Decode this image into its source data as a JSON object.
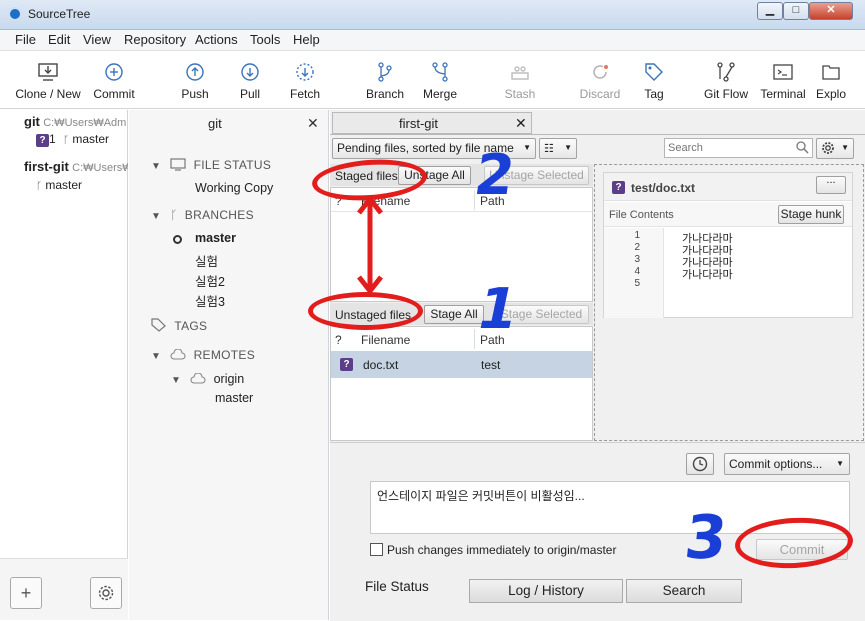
{
  "window": {
    "title": "SourceTree",
    "min": "▁",
    "max": "□",
    "close": "✕"
  },
  "menu": [
    "File",
    "Edit",
    "View",
    "Repository",
    "Actions",
    "Tools",
    "Help"
  ],
  "toolbar": {
    "clone": "Clone / New",
    "commit": "Commit",
    "push": "Push",
    "pull": "Pull",
    "fetch": "Fetch",
    "branch": "Branch",
    "merge": "Merge",
    "stash": "Stash",
    "discard": "Discard",
    "tag": "Tag",
    "gitflow": "Git Flow",
    "terminal": "Terminal",
    "explorer": "Explo"
  },
  "repos": [
    {
      "name": "git",
      "path": "C:₩Users₩Adm",
      "badge": "?",
      "badge_count": "1",
      "branch": "master"
    },
    {
      "name": "first-git",
      "path": "C:₩Users₩",
      "branch": "master"
    }
  ],
  "repo_scroll": "|||",
  "repo_add": "+",
  "sidebar": {
    "tab_title": "git",
    "close": "✕",
    "file_status": "FILE STATUS",
    "working_copy": "Working Copy",
    "branches": "BRANCHES",
    "branch_list": [
      "master",
      "실험",
      "실험2",
      "실험3"
    ],
    "tags": "TAGS",
    "remotes": "REMOTES",
    "remote_name": "origin",
    "remote_branch": "master"
  },
  "main": {
    "tab_title": "first-git",
    "tab_close": "✕",
    "sort_dropdown": "Pending files, sorted by file name",
    "search_placeholder": "Search",
    "staged": {
      "title": "Staged files",
      "unstage_all": "Unstage All",
      "unstage_selected": "Unstage Selected"
    },
    "unstaged": {
      "title": "Unstaged files",
      "stage_all": "Stage All",
      "stage_selected": "Stage Selected"
    },
    "columns": {
      "status": "?",
      "filename": "Filename",
      "path": "Path"
    },
    "unstaged_rows": [
      {
        "status": "?",
        "filename": "doc.txt",
        "path": "test"
      }
    ],
    "diff": {
      "file": "test/doc.txt",
      "badge": "?",
      "menu": "...",
      "contents_label": "File Contents",
      "stage_hunk": "Stage hunk",
      "lines": [
        {
          "n": "1",
          "text": "가나다라마"
        },
        {
          "n": "2",
          "text": "가나다라마"
        },
        {
          "n": "3",
          "text": "가나다라마"
        },
        {
          "n": "4",
          "text": "가나다라마"
        },
        {
          "n": "5",
          "text": ""
        }
      ]
    },
    "commit_options": "Commit options...",
    "commit_message": "언스테이지 파일은 커밋버튼이 비활성임...",
    "push_immediately": "Push changes immediately to origin/master",
    "commit_button": "Commit",
    "bottom_tabs": [
      "File Status",
      "Log / History",
      "Search"
    ]
  },
  "annotations": {
    "num1": "1",
    "num2": "2",
    "num3": "3"
  },
  "colors": {
    "annotation_red": "#e31c1c",
    "annotation_blue": "#1a3fd6",
    "selected_row": "#c5d3e2",
    "badge": "#5b3e8a"
  }
}
